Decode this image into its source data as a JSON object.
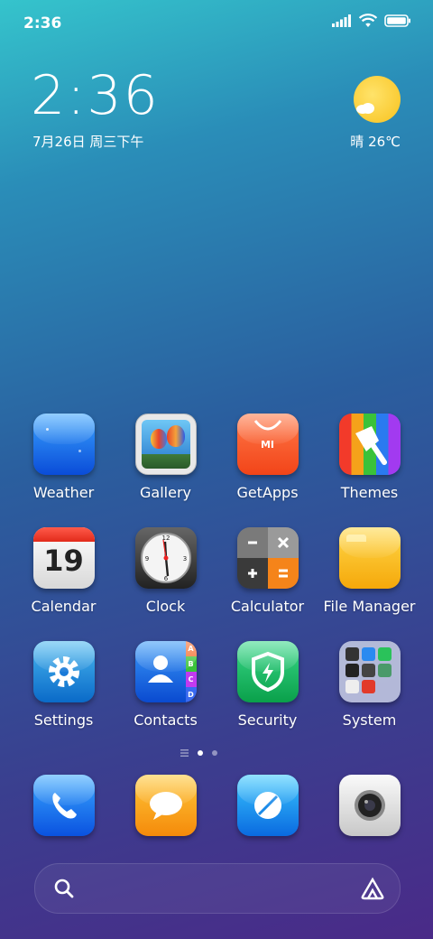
{
  "status_bar": {
    "time": "2:36"
  },
  "lockclock": {
    "time": "2:36",
    "date": "7月26日 周三下午"
  },
  "weather_widget": {
    "condition": "晴",
    "temp": "26℃"
  },
  "apps": [
    {
      "label": "Weather",
      "icon": "weather-icon"
    },
    {
      "label": "Gallery",
      "icon": "gallery-icon"
    },
    {
      "label": "GetApps",
      "icon": "getapps-icon"
    },
    {
      "label": "Themes",
      "icon": "themes-icon"
    },
    {
      "label": "Calendar",
      "icon": "calendar-icon",
      "badge": "19"
    },
    {
      "label": "Clock",
      "icon": "clock-icon"
    },
    {
      "label": "Calculator",
      "icon": "calculator-icon"
    },
    {
      "label": "File Manager",
      "icon": "file-manager-icon"
    },
    {
      "label": "Settings",
      "icon": "settings-icon"
    },
    {
      "label": "Contacts",
      "icon": "contacts-icon",
      "tabs": [
        "A",
        "B",
        "C",
        "D"
      ]
    },
    {
      "label": "Security",
      "icon": "security-icon"
    },
    {
      "label": "System",
      "icon": "system-folder-icon"
    }
  ],
  "getapps_logo": "mi",
  "dock": [
    {
      "icon": "phone-icon"
    },
    {
      "icon": "messaging-icon"
    },
    {
      "icon": "browser-icon"
    },
    {
      "icon": "camera-icon"
    }
  ],
  "colors": {
    "accent": "#1e8cf0"
  }
}
